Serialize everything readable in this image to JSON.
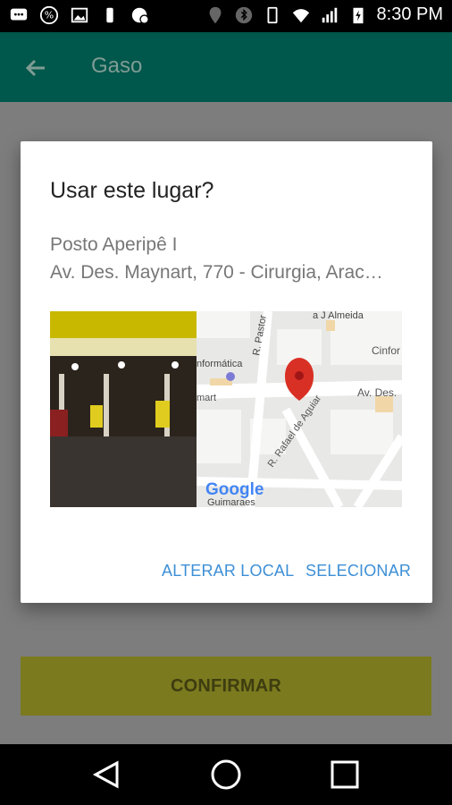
{
  "status_bar": {
    "time": "8:30 PM"
  },
  "app_bar": {
    "title": "Gaso"
  },
  "dialog": {
    "title": "Usar este lugar?",
    "place_name": "Posto Aperipê I",
    "place_address": "Av. Des. Maynart, 770 - Cirurgia, Arac…",
    "map_labels": {
      "almeida": "a J Almeida",
      "pastor": "R. Pastor",
      "informatica": "nformática",
      "cinfor": "Cinfor",
      "avdes": "Av. Des.",
      "mart": "mart",
      "rafael": "R. Rafael de Aguiar",
      "google": "Google",
      "guimaraes": "Guimaraes"
    },
    "buttons": {
      "change_location": "ALTERAR LOCAL",
      "select": "SELECIONAR"
    }
  },
  "confirm_button": {
    "label": "CONFIRMAR"
  },
  "colors": {
    "app_bar": "#00574b",
    "accent_blue": "#3d8fd6",
    "confirm": "#7b7a1f",
    "map_pin": "#d93025"
  },
  "icons": [
    "back-arrow-icon",
    "triangle-back-icon",
    "circle-home-icon",
    "square-recents-icon"
  ]
}
